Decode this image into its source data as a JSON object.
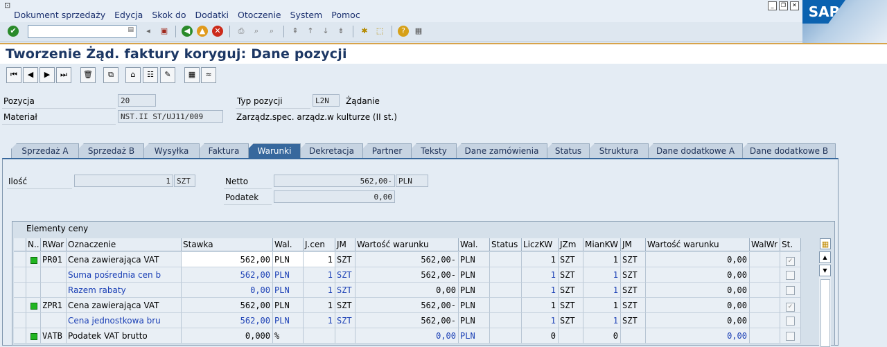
{
  "menu": {
    "items": [
      "Dokument sprzedaży",
      "Edycja",
      "Skok do",
      "Dodatki",
      "Otoczenie",
      "System",
      "Pomoc"
    ]
  },
  "logo": "SAP",
  "toolbar": {
    "command_value": ""
  },
  "page": {
    "title": "Tworzenie Żąd. faktury koryguj: Dane pozycji"
  },
  "header": {
    "pozycja_label": "Pozycja",
    "pozycja_value": "20",
    "typ_label": "Typ pozycji",
    "typ_value": "L2N",
    "typ_desc": "Żądanie",
    "material_label": "Materiał",
    "material_value": "NST.II ST/UJ11/009",
    "material_desc": "Zarządz.spec. arządz.w kulturze (II st.)"
  },
  "tabs": [
    {
      "label": "Sprzedaż A",
      "active": false
    },
    {
      "label": "Sprzedaż B",
      "active": false
    },
    {
      "label": "Wysyłka",
      "active": false
    },
    {
      "label": "Faktura",
      "active": false
    },
    {
      "label": "Warunki",
      "active": true
    },
    {
      "label": "Dekretacja",
      "active": false
    },
    {
      "label": "Partner",
      "active": false
    },
    {
      "label": "Teksty",
      "active": false
    },
    {
      "label": "Dane zamówienia",
      "active": false
    },
    {
      "label": "Status",
      "active": false
    },
    {
      "label": "Struktura",
      "active": false
    },
    {
      "label": "Dane dodatkowe A",
      "active": false
    },
    {
      "label": "Dane dodatkowe B",
      "active": false
    }
  ],
  "conditions": {
    "ilosc_label": "Ilość",
    "ilosc_value": "1",
    "ilosc_unit": "SZT",
    "netto_label": "Netto",
    "netto_value": "562,00-",
    "netto_currency": "PLN",
    "podatek_label": "Podatek",
    "podatek_value": "0,00"
  },
  "table": {
    "caption": "Elementy ceny",
    "headers": [
      "N..",
      "RWar",
      "Oznaczenie",
      "Stawka",
      "Wal.",
      "J.cen",
      "JM",
      "Wartość warunku",
      "Wal.",
      "Status",
      "LiczKW",
      "JZm",
      "MianKW",
      "JM",
      "Wartość warunku",
      "WalWr",
      "St."
    ],
    "rows": [
      {
        "led": true,
        "rwar": "PR01",
        "ozn": "Cena zawierająca VAT",
        "stawka": "562,00",
        "wal": "PLN",
        "jcen": "1",
        "jm": "SZT",
        "wart": "562,00-",
        "wal2": "PLN",
        "status": "",
        "liczkw": "1",
        "jzm": "SZT",
        "miankw": "1",
        "jm2": "SZT",
        "wart2": "0,00",
        "walwr": "",
        "st": "checked",
        "blue": false,
        "editable": true
      },
      {
        "led": false,
        "rwar": "",
        "ozn": "Suma pośrednia cen b",
        "stawka": "562,00",
        "wal": "PLN",
        "jcen": "1",
        "jm": "SZT",
        "wart": "562,00-",
        "wal2": "PLN",
        "status": "",
        "liczkw": "1",
        "jzm": "SZT",
        "miankw": "1",
        "jm2": "SZT",
        "wart2": "0,00",
        "walwr": "",
        "st": "",
        "blue": true,
        "editable": false
      },
      {
        "led": false,
        "rwar": "",
        "ozn": "Razem rabaty",
        "stawka": "0,00",
        "wal": "PLN",
        "jcen": "1",
        "jm": "SZT",
        "wart": "0,00",
        "wal2": "PLN",
        "status": "",
        "liczkw": "1",
        "jzm": "SZT",
        "miankw": "1",
        "jm2": "SZT",
        "wart2": "0,00",
        "walwr": "",
        "st": "",
        "blue": true,
        "editable": false
      },
      {
        "led": true,
        "rwar": "ZPR1",
        "ozn": "Cena zawierająca VAT",
        "stawka": "562,00",
        "wal": "PLN",
        "jcen": "1",
        "jm": "SZT",
        "wart": "562,00-",
        "wal2": "PLN",
        "status": "",
        "liczkw": "1",
        "jzm": "SZT",
        "miankw": "1",
        "jm2": "SZT",
        "wart2": "0,00",
        "walwr": "",
        "st": "checked",
        "blue": false,
        "editable": false
      },
      {
        "led": false,
        "rwar": "",
        "ozn": "Cena jednostkowa bru",
        "stawka": "562,00",
        "wal": "PLN",
        "jcen": "1",
        "jm": "SZT",
        "wart": "562,00-",
        "wal2": "PLN",
        "status": "",
        "liczkw": "1",
        "jzm": "SZT",
        "miankw": "1",
        "jm2": "SZT",
        "wart2": "0,00",
        "walwr": "",
        "st": "",
        "blue": true,
        "editable": false
      },
      {
        "led": true,
        "rwar": "VATB",
        "ozn": "Podatek VAT brutto",
        "stawka": "0,000",
        "wal": "%",
        "jcen": "",
        "jm": "",
        "wart": "0,00",
        "wal2": "PLN",
        "status": "",
        "liczkw": "0",
        "jzm": "",
        "miankw": "0",
        "jm2": "",
        "wart2": "0,00",
        "walwr": "",
        "st": "",
        "blue": false,
        "editable": false,
        "value_blue": true
      }
    ]
  },
  "colors": {
    "accent": "#37689d",
    "title": "#1c3764",
    "link_blue": "#1a3fb5",
    "led_green": "#21b521"
  }
}
